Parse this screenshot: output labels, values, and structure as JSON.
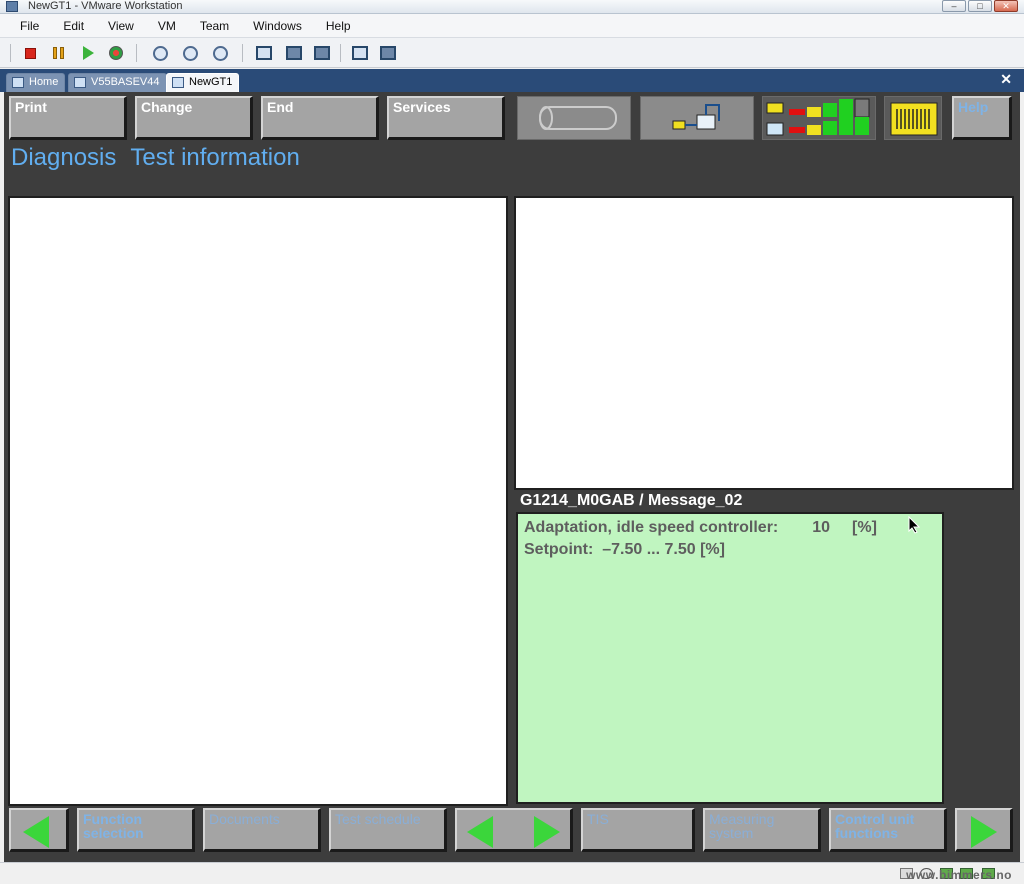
{
  "window": {
    "title": "NewGT1 - VMware Workstation"
  },
  "menu": [
    "File",
    "Edit",
    "View",
    "VM",
    "Team",
    "Windows",
    "Help"
  ],
  "tabs": [
    {
      "label": "Home"
    },
    {
      "label": "V55BASEV44"
    },
    {
      "label": "NewGT1"
    }
  ],
  "top_buttons": {
    "print": "Print",
    "change": "Change",
    "end": "End",
    "services": "Services",
    "help": "Help"
  },
  "heading": {
    "part1": "Diagnosis",
    "part2": "Test information"
  },
  "message": {
    "title": "G1214_M0GAB / Message_02",
    "line1_label": "Adaptation, idle speed controller:",
    "line1_value": "10",
    "line1_unit": "[%]",
    "line2": "Setpoint:  –7.50 ... 7.50 [%]"
  },
  "bottom_buttons": {
    "function_selection": "Function selection",
    "documents": "Documents",
    "test_schedule": "Test schedule",
    "tis": "TIS",
    "measuring_system": "Measuring system",
    "control_unit_functions": "Control unit functions"
  },
  "watermark": "www.bimmers.no",
  "colors": {
    "guest_bg": "#3d3d3d",
    "heading": "#61aef0",
    "message_bg": "#c0f5c0",
    "arrow": "#3bd63b"
  }
}
